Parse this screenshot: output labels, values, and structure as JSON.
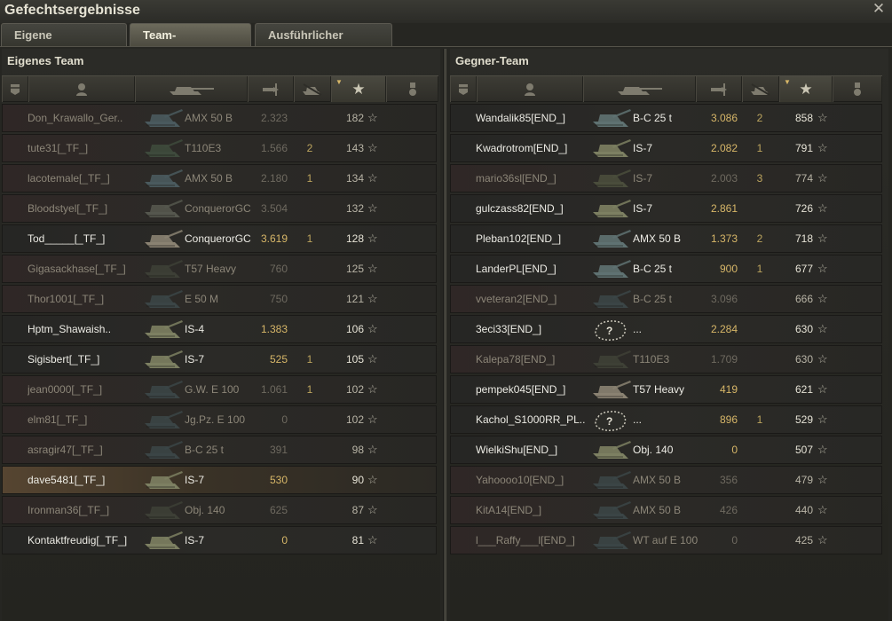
{
  "window": {
    "title": "Gefechtsergebnisse",
    "close_icon": "close-icon"
  },
  "tabs": [
    {
      "label": "Eigene Auswertung",
      "active": false
    },
    {
      "label": "Team-Auswertung",
      "active": true
    },
    {
      "label": "Ausführlicher Bericht",
      "active": false
    }
  ],
  "columns": {
    "icons": [
      "platoon-icon",
      "player-icon",
      "tank-icon",
      "damage-icon",
      "kills-icon",
      "xp-star-icon",
      "medal-icon"
    ],
    "sorted_column": "xp-star-icon"
  },
  "own_team": {
    "title": "Eigenes Team",
    "rows": [
      {
        "name": "Don_Krawallo_Ger..",
        "tank": "AMX 50 B",
        "damage": "2.323",
        "kills": "",
        "xp": "182",
        "alive": false,
        "me": false,
        "tank_color": "#4a5a5e"
      },
      {
        "name": "tute31[_TF_]",
        "tank": "T110E3",
        "damage": "1.566",
        "kills": "2",
        "xp": "143",
        "alive": false,
        "me": false,
        "tank_color": "#3e4a3c"
      },
      {
        "name": "lacotemale[_TF_]",
        "tank": "AMX 50 B",
        "damage": "2.180",
        "kills": "1",
        "xp": "134",
        "alive": false,
        "me": false,
        "tank_color": "#4a5a5e"
      },
      {
        "name": "Bloodstyel[_TF_]",
        "tank": "ConquerorGC",
        "damage": "3.504",
        "kills": "",
        "xp": "132",
        "alive": false,
        "me": false,
        "tank_color": "#55574e"
      },
      {
        "name": "Tod_____[_TF_]",
        "tank": "ConquerorGC",
        "damage": "3.619",
        "kills": "1",
        "xp": "128",
        "alive": true,
        "me": false,
        "tank_color": "#8a8272"
      },
      {
        "name": "Gigasackhase[_TF_]",
        "tank": "T57 Heavy",
        "damage": "760",
        "kills": "",
        "xp": "125",
        "alive": false,
        "me": false,
        "tank_color": "#3d3f36"
      },
      {
        "name": "Thor1001[_TF_]",
        "tank": "E 50 M",
        "damage": "750",
        "kills": "",
        "xp": "121",
        "alive": false,
        "me": false,
        "tank_color": "#3b4546"
      },
      {
        "name": "Hptm_Shawaish..",
        "tank": "IS-4",
        "damage": "1.383",
        "kills": "",
        "xp": "106",
        "alive": true,
        "me": false,
        "tank_color": "#7d8062"
      },
      {
        "name": "Sigisbert[_TF_]",
        "tank": "IS-7",
        "damage": "525",
        "kills": "1",
        "xp": "105",
        "alive": true,
        "me": false,
        "tank_color": "#7d8062"
      },
      {
        "name": "jean0000[_TF_]",
        "tank": "G.W. E 100",
        "damage": "1.061",
        "kills": "1",
        "xp": "102",
        "alive": false,
        "me": false,
        "tank_color": "#3b4546"
      },
      {
        "name": "elm81[_TF_]",
        "tank": "Jg.Pz. E 100",
        "damage": "0",
        "kills": "",
        "xp": "102",
        "alive": false,
        "me": false,
        "tank_color": "#3b4546"
      },
      {
        "name": "asragir47[_TF_]",
        "tank": "B-C 25 t",
        "damage": "391",
        "kills": "",
        "xp": "98",
        "alive": false,
        "me": false,
        "tank_color": "#3b4546"
      },
      {
        "name": "dave5481[_TF_]",
        "tank": "IS-7",
        "damage": "530",
        "kills": "",
        "xp": "90",
        "alive": true,
        "me": true,
        "tank_color": "#7d8062"
      },
      {
        "name": "Ironman36[_TF_]",
        "tank": "Obj. 140",
        "damage": "625",
        "kills": "",
        "xp": "87",
        "alive": false,
        "me": false,
        "tank_color": "#3d3f36"
      },
      {
        "name": "Kontaktfreudig[_TF_]",
        "tank": "IS-7",
        "damage": "0",
        "kills": "",
        "xp": "81",
        "alive": true,
        "me": false,
        "tank_color": "#7d8062"
      }
    ]
  },
  "enemy_team": {
    "title": "Gegner-Team",
    "rows": [
      {
        "name": "Wandalik85[END_]",
        "tank": "B-C 25 t",
        "damage": "3.086",
        "kills": "2",
        "xp": "858",
        "alive": true,
        "unknown": false,
        "tank_color": "#5f7272"
      },
      {
        "name": "Kwadrotrom[END_]",
        "tank": "IS-7",
        "damage": "2.082",
        "kills": "1",
        "xp": "791",
        "alive": true,
        "unknown": false,
        "tank_color": "#7d8062"
      },
      {
        "name": "mario36sl[END_]",
        "tank": "IS-7",
        "damage": "2.003",
        "kills": "3",
        "xp": "774",
        "alive": false,
        "unknown": false,
        "tank_color": "#4a4d3c"
      },
      {
        "name": "gulczass82[END_]",
        "tank": "IS-7",
        "damage": "2.861",
        "kills": "",
        "xp": "726",
        "alive": true,
        "unknown": false,
        "tank_color": "#7d8062"
      },
      {
        "name": "Pleban102[END_]",
        "tank": "AMX 50 B",
        "damage": "1.373",
        "kills": "2",
        "xp": "718",
        "alive": true,
        "unknown": false,
        "tank_color": "#5f7272"
      },
      {
        "name": "LanderPL[END_]",
        "tank": "B-C 25 t",
        "damage": "900",
        "kills": "1",
        "xp": "677",
        "alive": true,
        "unknown": false,
        "tank_color": "#5f7272"
      },
      {
        "name": "vveteran2[END_]",
        "tank": "B-C 25 t",
        "damage": "3.096",
        "kills": "",
        "xp": "666",
        "alive": false,
        "unknown": false,
        "tank_color": "#3b4546"
      },
      {
        "name": "3eci33[END_]",
        "tank": "...",
        "damage": "2.284",
        "kills": "",
        "xp": "630",
        "alive": true,
        "unknown": true,
        "tank_color": "#2a2a2a"
      },
      {
        "name": "Kalepa78[END_]",
        "tank": "T110E3",
        "damage": "1.709",
        "kills": "",
        "xp": "630",
        "alive": false,
        "unknown": false,
        "tank_color": "#3e4036"
      },
      {
        "name": "pempek045[END_]",
        "tank": "T57 Heavy",
        "damage": "419",
        "kills": "",
        "xp": "621",
        "alive": true,
        "unknown": false,
        "tank_color": "#8a8272"
      },
      {
        "name": "Kachol_S1000RR_PL..",
        "tank": "...",
        "damage": "896",
        "kills": "1",
        "xp": "529",
        "alive": true,
        "unknown": true,
        "tank_color": "#2a2a2a"
      },
      {
        "name": "WielkiShu[END_]",
        "tank": "Obj. 140",
        "damage": "0",
        "kills": "",
        "xp": "507",
        "alive": true,
        "unknown": false,
        "tank_color": "#7d8062"
      },
      {
        "name": "Yahoooo10[END_]",
        "tank": "AMX 50 B",
        "damage": "356",
        "kills": "",
        "xp": "479",
        "alive": false,
        "unknown": false,
        "tank_color": "#3b4546"
      },
      {
        "name": "KitA14[END_]",
        "tank": "AMX 50 B",
        "damage": "426",
        "kills": "",
        "xp": "440",
        "alive": false,
        "unknown": false,
        "tank_color": "#3b4546"
      },
      {
        "name": "l___Raffy___l[END_]",
        "tank": "WT auf E 100",
        "damage": "0",
        "kills": "",
        "xp": "425",
        "alive": false,
        "unknown": false,
        "tank_color": "#3b4546"
      }
    ]
  },
  "row_star": "☆"
}
